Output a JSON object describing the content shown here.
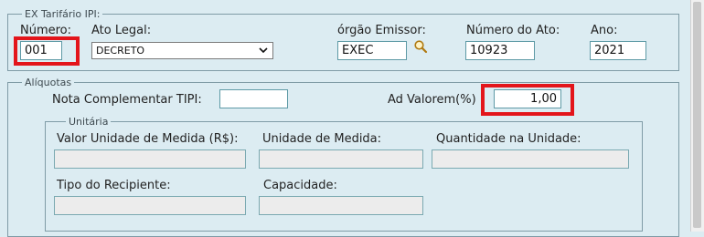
{
  "ex_tarifario": {
    "legend": "EX Tarifário IPI:",
    "numero": {
      "label": "Número:",
      "value": "001"
    },
    "ato_legal": {
      "label": "Ato Legal:",
      "selected": "DECRETO"
    },
    "orgao_emissor": {
      "label": "órgão Emissor:",
      "value": "EXEC",
      "search_icon": "magnifier-icon"
    },
    "numero_ato": {
      "label": "Número do Ato:",
      "value": "10923"
    },
    "ano": {
      "label": "Ano:",
      "value": "2021"
    }
  },
  "aliquotas": {
    "legend": "Alíquotas",
    "nota_complementar": {
      "label": "Nota Complementar TIPI:",
      "value": ""
    },
    "ad_valorem": {
      "label": "Ad Valorem(%)",
      "value": "1,00"
    },
    "unitaria": {
      "legend": "Unitária",
      "valor_unidade": {
        "label": "Valor Unidade de Medida (R$):",
        "value": ""
      },
      "unidade_medida": {
        "label": "Unidade de Medida:",
        "value": ""
      },
      "quantidade_unidade": {
        "label": "Quantidade na Unidade:",
        "value": ""
      },
      "tipo_recipiente": {
        "label": "Tipo do Recipiente:",
        "value": ""
      },
      "capacidade": {
        "label": "Capacidade:",
        "value": ""
      }
    }
  },
  "colors": {
    "highlight": "#e3151b",
    "field_border": "#5e9aa6",
    "background": "#dcecf2"
  }
}
